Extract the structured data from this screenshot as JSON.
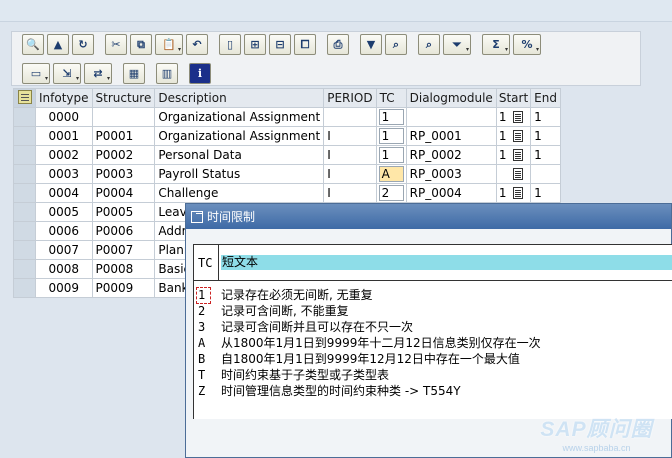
{
  "toolbar": {
    "row1": [
      {
        "icon": "display-change-icon",
        "glyph": "🔍"
      },
      {
        "icon": "choose-icon",
        "glyph": "▲"
      },
      {
        "icon": "refresh-icon",
        "glyph": "↻"
      },
      {
        "icon": "cut-icon",
        "glyph": "✂"
      },
      {
        "icon": "copy-icon",
        "glyph": "⧉"
      },
      {
        "icon": "paste-icon",
        "glyph": "📋",
        "dropdown": true
      },
      {
        "icon": "undo-icon",
        "glyph": "↶"
      },
      {
        "icon": "new-entry-icon",
        "glyph": "▯"
      },
      {
        "icon": "insert-row-icon",
        "glyph": "⊞"
      },
      {
        "icon": "delete-row-icon",
        "glyph": "⊟"
      },
      {
        "icon": "duplicate-row-icon",
        "glyph": "⧠"
      },
      {
        "icon": "print-icon",
        "glyph": "⎙"
      },
      {
        "icon": "filter-icon",
        "glyph": "▼"
      },
      {
        "icon": "find-icon",
        "glyph": "⌕"
      },
      {
        "icon": "find-next-icon",
        "glyph": "⌕"
      },
      {
        "icon": "set-filter-icon",
        "glyph": "⏷",
        "dropdown": true
      },
      {
        "icon": "sum-icon",
        "glyph": "Σ",
        "dropdown": true
      },
      {
        "icon": "subtotal-icon",
        "glyph": "%",
        "dropdown": true
      }
    ],
    "row2": [
      {
        "icon": "print-preview-icon",
        "glyph": "▭",
        "dropdown": true
      },
      {
        "icon": "export-icon",
        "glyph": "⇲",
        "dropdown": true
      },
      {
        "icon": "views-icon",
        "glyph": "⇄",
        "dropdown": true
      },
      {
        "icon": "layout-icon",
        "glyph": "▦"
      },
      {
        "icon": "graphic-icon",
        "glyph": "▥"
      },
      {
        "icon": "info-icon",
        "glyph": "i"
      }
    ]
  },
  "table": {
    "headers": {
      "infotype": "Infotype",
      "structure": "Structure",
      "description": "Description",
      "period": "PERIOD",
      "tc": "TC",
      "dialogmodule": "Dialogmodule",
      "start": "Start",
      "end": "End"
    },
    "rows": [
      {
        "infotype": "0000",
        "structure": "",
        "description": "Organizational Assignment",
        "period": "",
        "tc": "1",
        "dialogmodule": "",
        "start": "1",
        "end": "1"
      },
      {
        "infotype": "0001",
        "structure": "P0001",
        "description": "Organizational Assignment",
        "period": "I",
        "tc": "1",
        "dialogmodule": "RP_0001",
        "start": "1",
        "end": "1"
      },
      {
        "infotype": "0002",
        "structure": "P0002",
        "description": "Personal Data",
        "period": "I",
        "tc": "1",
        "dialogmodule": "RP_0002",
        "start": "1",
        "end": "1"
      },
      {
        "infotype": "0003",
        "structure": "P0003",
        "description": "Payroll Status",
        "period": "I",
        "tc": "A",
        "dialogmodule": "RP_0003",
        "start": "",
        "end": ""
      },
      {
        "infotype": "0004",
        "structure": "P0004",
        "description": "Challenge",
        "period": "I",
        "tc": "2",
        "dialogmodule": "RP_0004",
        "start": "1",
        "end": "1"
      },
      {
        "infotype": "0005",
        "structure": "P0005",
        "description": "Leave",
        "period": "",
        "tc": "",
        "dialogmodule": "",
        "start": "",
        "end": ""
      },
      {
        "infotype": "0006",
        "structure": "P0006",
        "description": "Addre",
        "period": "",
        "tc": "",
        "dialogmodule": "",
        "start": "",
        "end": ""
      },
      {
        "infotype": "0007",
        "structure": "P0007",
        "description": "Planne",
        "period": "",
        "tc": "",
        "dialogmodule": "",
        "start": "",
        "end": ""
      },
      {
        "infotype": "0008",
        "structure": "P0008",
        "description": "Basic P",
        "period": "",
        "tc": "",
        "dialogmodule": "",
        "start": "",
        "end": ""
      },
      {
        "infotype": "0009",
        "structure": "P0009",
        "description": "Bank D",
        "period": "",
        "tc": "",
        "dialogmodule": "",
        "start": "",
        "end": ""
      }
    ]
  },
  "popup": {
    "title": "时间限制",
    "header_tc": "TC",
    "header_text": "短文本",
    "options": [
      {
        "code": "1",
        "text": "记录存在必须无间断, 无重复"
      },
      {
        "code": "2",
        "text": "记录可含间断, 不能重复"
      },
      {
        "code": "3",
        "text": "记录可含间断并且可以存在不只一次"
      },
      {
        "code": "A",
        "text": "从1800年1月1日到9999年十二月12日信息类别仅存在一次"
      },
      {
        "code": "B",
        "text": "自1800年1月1日到9999年12月12日中存在一个最大值"
      },
      {
        "code": "T",
        "text": "时间约束基于子类型或子类型表"
      },
      {
        "code": "Z",
        "text": "时间管理信息类型的时间约束种类 -> T554Y"
      }
    ]
  },
  "watermark": {
    "main": "SAP顾问圈",
    "sub": "www.sapbaba.cn"
  },
  "colors": {
    "popup_title_bar": "#3e6aa6",
    "header_highlight": "#8edde8",
    "tc_highlight": "#ffe7a8"
  }
}
